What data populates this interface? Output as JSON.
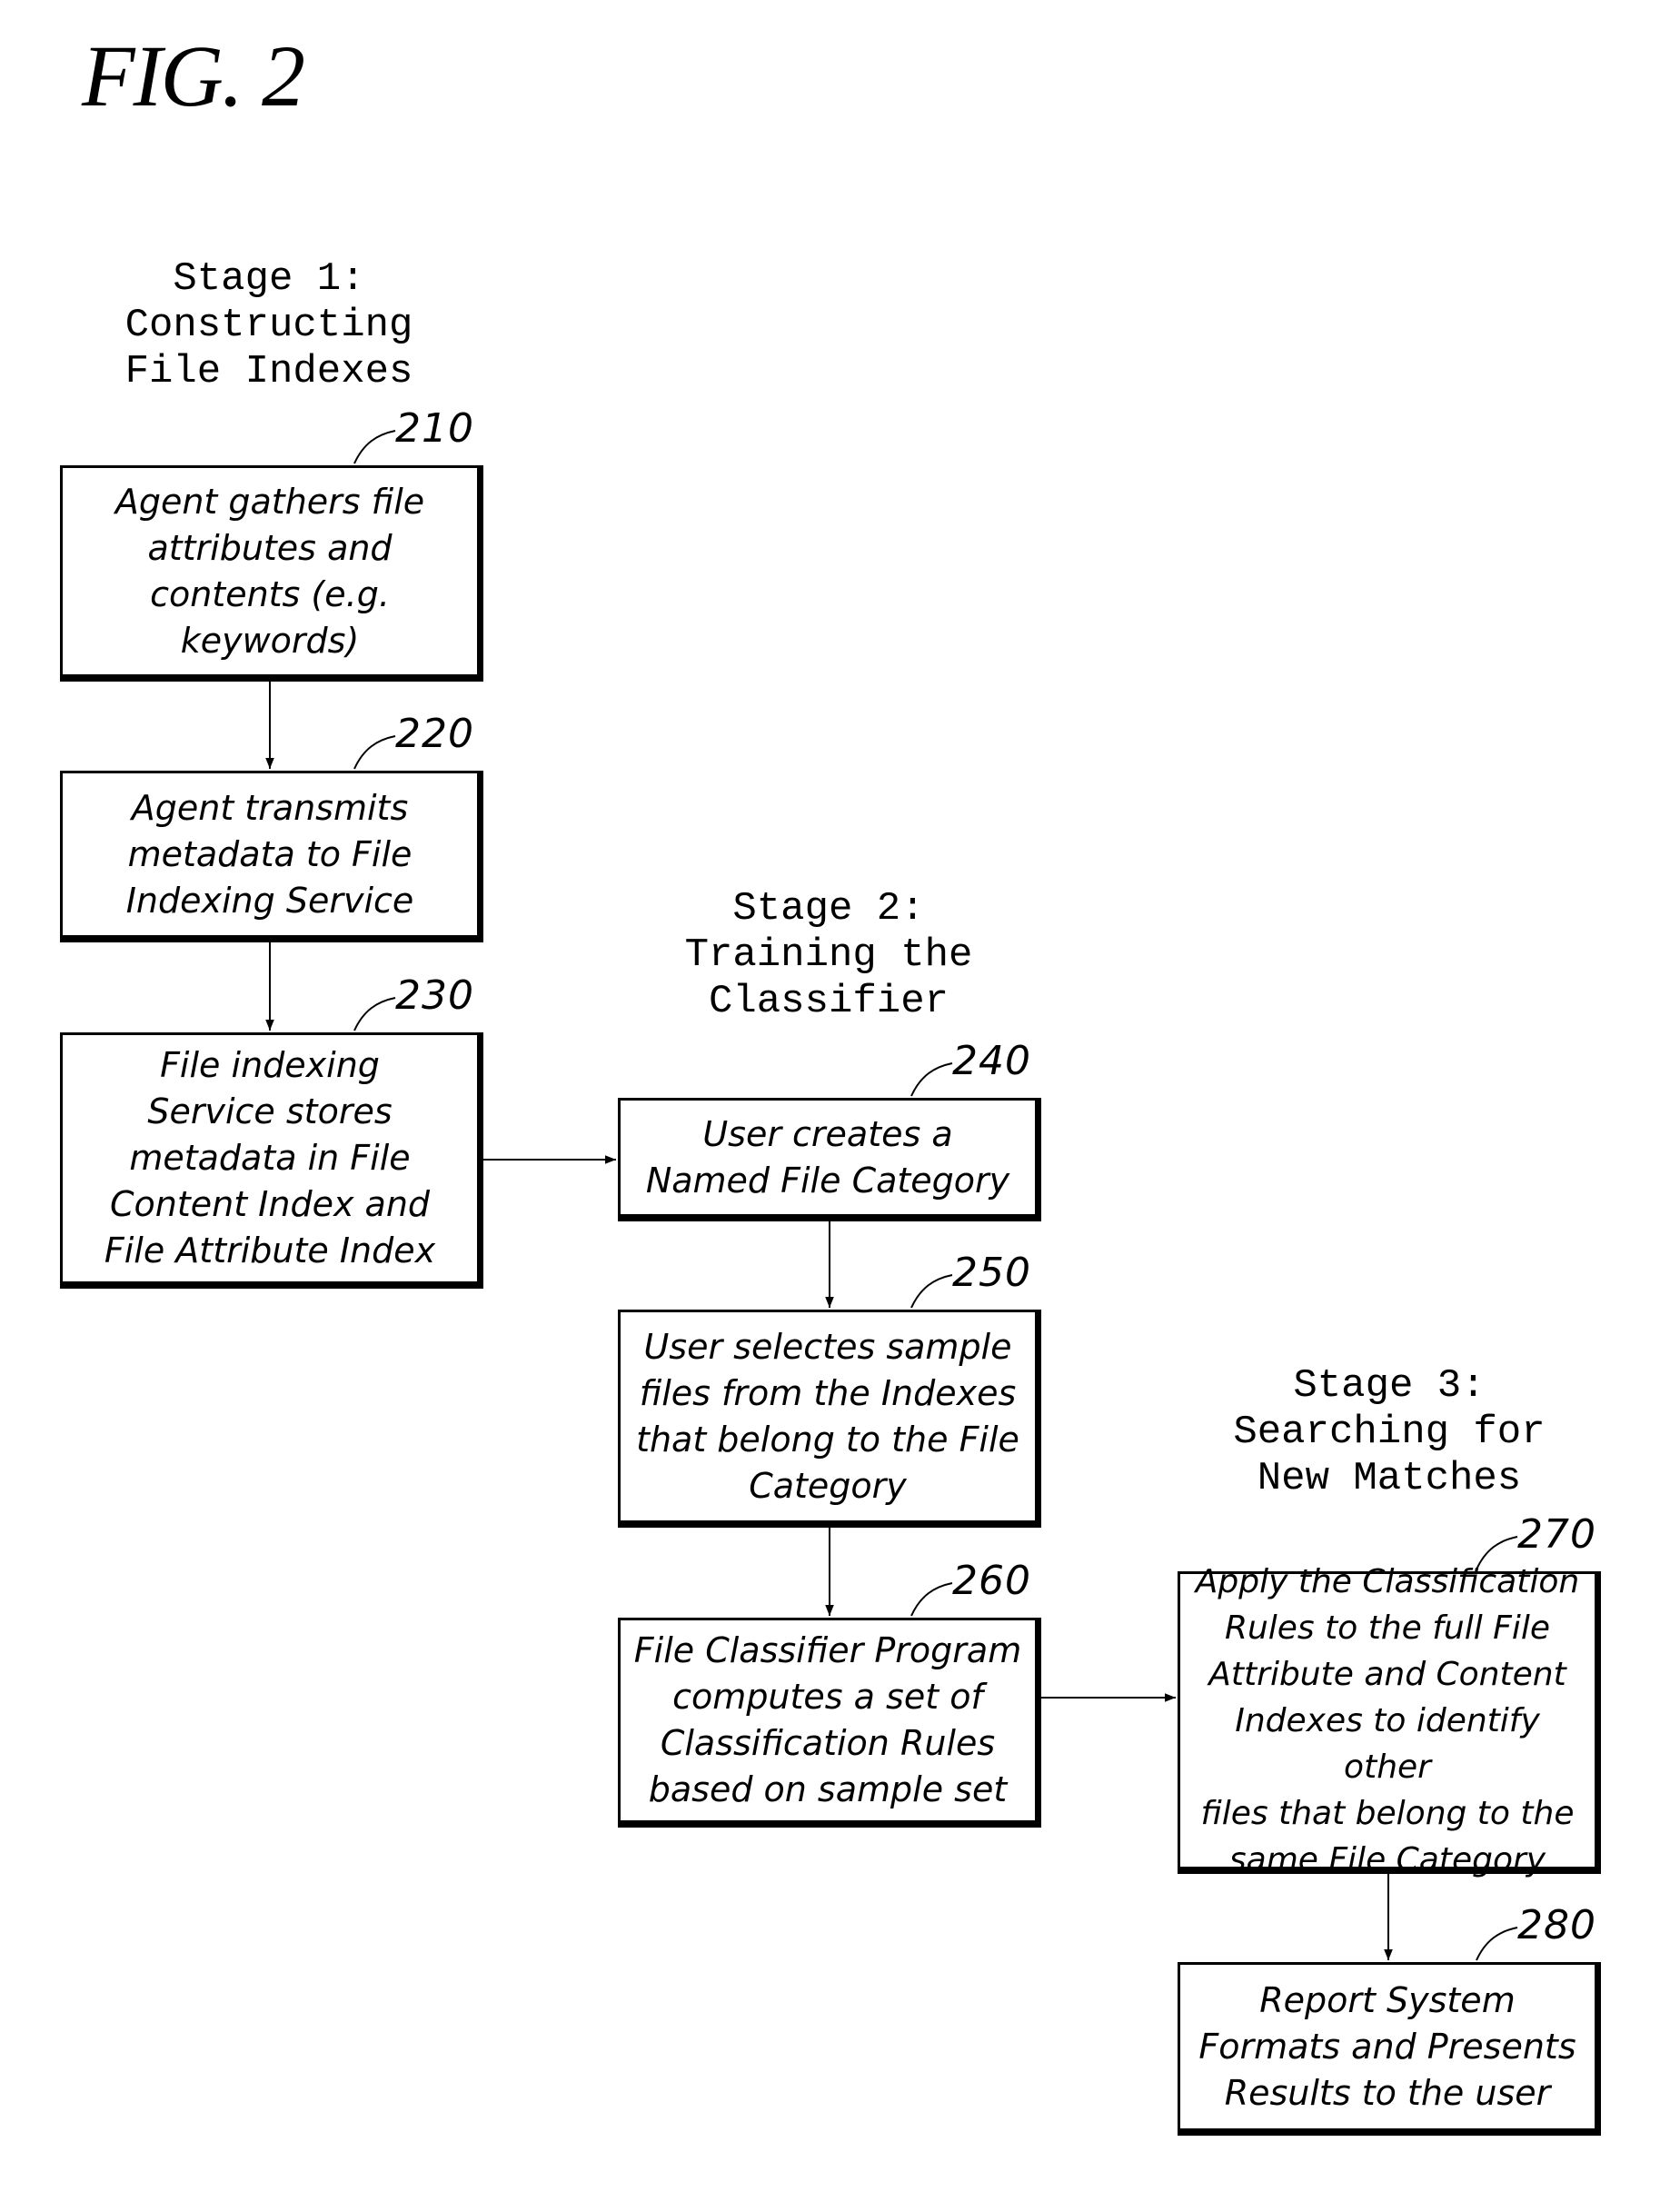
{
  "figure": {
    "title": "FIG. 2"
  },
  "stages": [
    {
      "id": "stage-1",
      "label": "Stage 1:\nConstructing\nFile Indexes"
    },
    {
      "id": "stage-2",
      "label": "Stage 2:\nTraining the\nClassifier"
    },
    {
      "id": "stage-3",
      "label": "Stage 3:\nSearching for\nNew Matches"
    }
  ],
  "steps": [
    {
      "ref": "210",
      "stage": "stage-1",
      "text": "Agent gathers file\nattributes and\ncontents (e.g.\nkeywords)"
    },
    {
      "ref": "220",
      "stage": "stage-1",
      "text": "Agent transmits\nmetadata to File\nIndexing Service"
    },
    {
      "ref": "230",
      "stage": "stage-1",
      "text": "File indexing\nService stores\nmetadata in File\nContent Index and\nFile Attribute Index"
    },
    {
      "ref": "240",
      "stage": "stage-2",
      "text": "User creates a\nNamed File Category"
    },
    {
      "ref": "250",
      "stage": "stage-2",
      "text": "User selectes sample\nfiles from the Indexes\nthat belong to the File\nCategory"
    },
    {
      "ref": "260",
      "stage": "stage-2",
      "text": "File Classifier Program\ncomputes a set of\nClassification Rules\nbased on sample set"
    },
    {
      "ref": "270",
      "stage": "stage-3",
      "text": "Apply the Classification\nRules to the full File\nAttribute and Content\nIndexes to identify other\nfiles that belong to the\nsame File Category"
    },
    {
      "ref": "280",
      "stage": "stage-3",
      "text": "Report System\nFormats and Presents\nResults to the user"
    }
  ],
  "edges": [
    {
      "from": "210",
      "to": "220"
    },
    {
      "from": "220",
      "to": "230"
    },
    {
      "from": "230",
      "to": "240"
    },
    {
      "from": "240",
      "to": "250"
    },
    {
      "from": "250",
      "to": "260"
    },
    {
      "from": "260",
      "to": "270"
    },
    {
      "from": "270",
      "to": "280"
    }
  ]
}
